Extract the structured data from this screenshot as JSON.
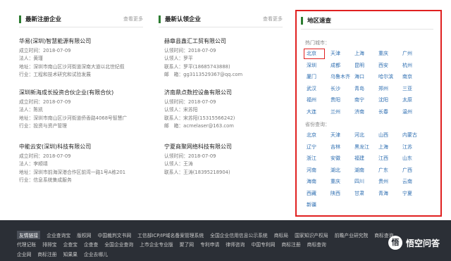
{
  "newly_registered": {
    "title": "最新注册企业",
    "more": "查看更多",
    "companies": [
      {
        "name": "华易(深圳)智慧能源有限公司",
        "rows": [
          "成立时间：2018-07-09",
          "法人：黄瑾",
          "地址：深圳市南山区沙河街道深南大道以北世纪假",
          "行业：工程和技术研究和试验发展"
        ]
      },
      {
        "name": "深圳新海成长投资合伙企业(有限合伙)",
        "rows": [
          "成立时间：2018-07-09",
          "法人：陈凯",
          "地址：深圳市南山区沙河街道侨香路4068号智慧广",
          "行业：投资与资产管理"
        ]
      },
      {
        "name": "中能云安(深圳)科技有限公司",
        "rows": [
          "成立时间：2018-07-09",
          "法人：李顺靖",
          "地址：深圳市前海深港合作区前湾一路1号A栋201",
          "行业：信息系统集成服务"
        ]
      }
    ]
  },
  "newly_certified": {
    "title": "最新认领企业",
    "more": "查看更多",
    "companies": [
      {
        "name": "赫章县鑫汇工贸有限公司",
        "rows": [
          "认领时间：2018-07-09",
          "认领人：罗平",
          "联系人：罗平(18685743888)",
          "邮　箱：gg3113529367@qq.com"
        ]
      },
      {
        "name": "济南鼎点数控设备有限公司",
        "rows": [
          "认领时间：2018-07-09",
          "认领人：宋苏阳",
          "联系人：宋苏阳(15315566242)",
          "邮　箱：acmelaser@163.com"
        ]
      },
      {
        "name": "宁夏商聚网络科技有限公司",
        "rows": [
          "认领时间：2018-07-09",
          "认领人：王涛",
          "联系人：王涛(18395218904)"
        ]
      }
    ]
  },
  "region": {
    "title": "地区速查",
    "hot_label": "热门城市：",
    "hot_cities": [
      "北京",
      "天津",
      "上海",
      "重庆",
      "广州",
      "深圳",
      "成都",
      "昆明",
      "西安",
      "杭州",
      "厦门",
      "乌鲁木齐",
      "海口",
      "哈尔滨",
      "南京",
      "武汉",
      "长沙",
      "青岛",
      "郑州",
      "三亚",
      "福州",
      "贵阳",
      "南宁",
      "沈阳",
      "太原",
      "大连",
      "兰州",
      "济南",
      "长春",
      "温州"
    ],
    "province_label": "省份查询：",
    "provinces": [
      "北京",
      "天津",
      "河北",
      "山西",
      "内蒙古",
      "辽宁",
      "吉林",
      "黑龙江",
      "上海",
      "江苏",
      "浙江",
      "安徽",
      "福建",
      "江西",
      "山东",
      "河南",
      "湖北",
      "湖南",
      "广东",
      "广西",
      "海南",
      "重庆",
      "四川",
      "贵州",
      "云南",
      "西藏",
      "陕西",
      "甘肃",
      "青海",
      "宁夏",
      "新疆"
    ]
  },
  "footer": {
    "friend_links_label": "友情链接",
    "row1": [
      "企业查询宝",
      "版权网",
      "中国裁判文书网",
      "工信部ICP/IP域名备案管理系统",
      "全国企业信用信息公示系统",
      "商标局",
      "国家知识产权局",
      "前瞻产业研究院",
      "商标查询"
    ],
    "row2": [
      "代理记账",
      "排排宝",
      "企查宝",
      "企查查",
      "全国企业查询",
      "上市企业专业版",
      "聚了网",
      "专利申请",
      "律师咨询",
      "中国专利网",
      "商标注册",
      "商标查询"
    ],
    "row3": [
      "企业网",
      "商标注册",
      "知果果",
      "企业去哪儿"
    ],
    "watermark": "悟空问答"
  }
}
